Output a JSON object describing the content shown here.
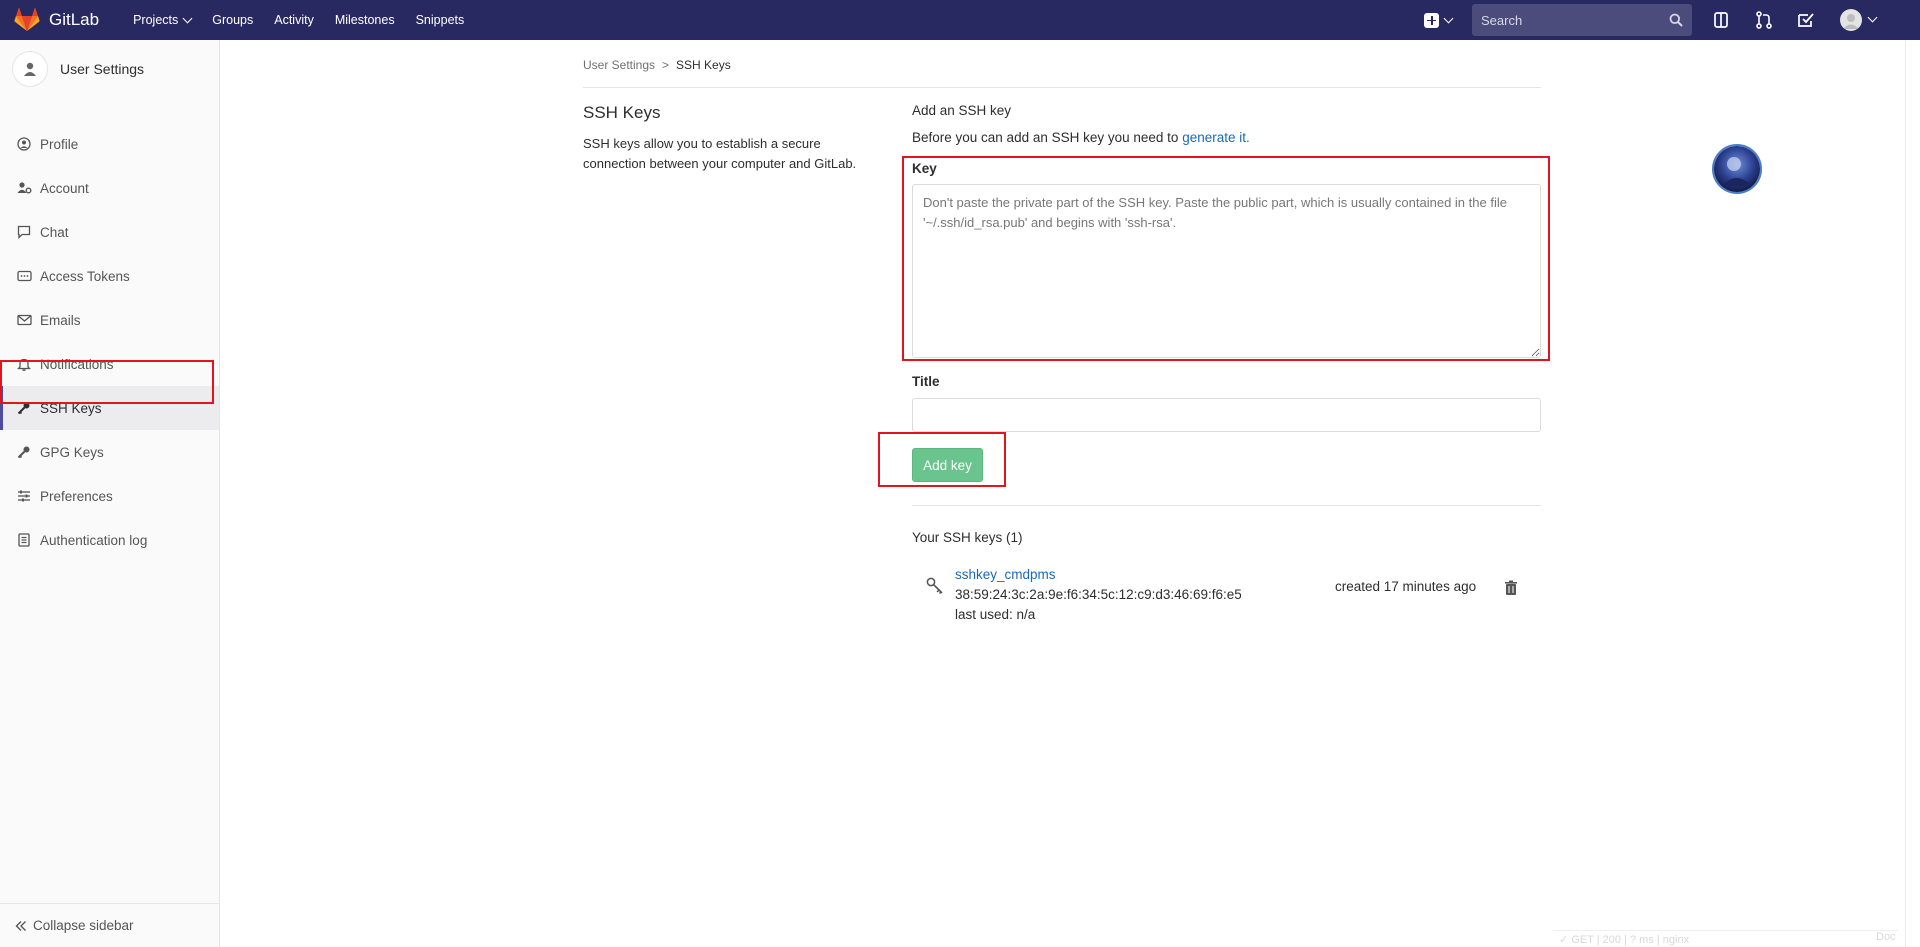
{
  "topbar": {
    "brand": "GitLab",
    "nav": [
      "Projects",
      "Groups",
      "Activity",
      "Milestones",
      "Snippets"
    ],
    "search_placeholder": "Search"
  },
  "sidebar": {
    "title": "User Settings",
    "items": [
      {
        "label": "Profile",
        "icon": "profile-icon"
      },
      {
        "label": "Account",
        "icon": "account-icon"
      },
      {
        "label": "Chat",
        "icon": "chat-icon"
      },
      {
        "label": "Access Tokens",
        "icon": "access-tokens-icon"
      },
      {
        "label": "Emails",
        "icon": "email-icon"
      },
      {
        "label": "Notifications",
        "icon": "bell-icon"
      },
      {
        "label": "SSH Keys",
        "icon": "key-icon",
        "active": true
      },
      {
        "label": "GPG Keys",
        "icon": "key-icon"
      },
      {
        "label": "Preferences",
        "icon": "sliders-icon"
      },
      {
        "label": "Authentication log",
        "icon": "log-icon"
      }
    ],
    "collapse_label": "Collapse sidebar"
  },
  "breadcrumb": {
    "parent": "User Settings",
    "sep": ">",
    "current": "SSH Keys"
  },
  "section": {
    "title": "SSH Keys",
    "description": "SSH keys allow you to establish a secure connection between your computer and GitLab."
  },
  "form": {
    "heading": "Add an SSH key",
    "intro": "Before you can add an SSH key you need to",
    "intro_link": "generate it.",
    "key_label": "Key",
    "key_placeholder": "Don't paste the private part of the SSH key. Paste the public part, which is usually contained in the file '~/.ssh/id_rsa.pub' and begins with 'ssh-rsa'.",
    "title_label": "Title",
    "title_value": "",
    "submit_label": "Add key"
  },
  "keys": {
    "heading": "Your SSH keys (1)",
    "items": [
      {
        "name": "sshkey_cmdpms",
        "fingerprint": "38:59:24:3c:2a:9e:f6:34:5c:12:c9:d3:46:69:f6:e5",
        "last_used": "last used: n/a",
        "created": "created 17 minutes ago"
      }
    ]
  },
  "footer_perf": "✓ GET | 200 | ? ms | nginx",
  "footer_doc": "Doc",
  "colors": {
    "topbar": "#292961",
    "accent": "#1b69b6",
    "success": "#69c48e",
    "highlight": "#e3141e"
  }
}
